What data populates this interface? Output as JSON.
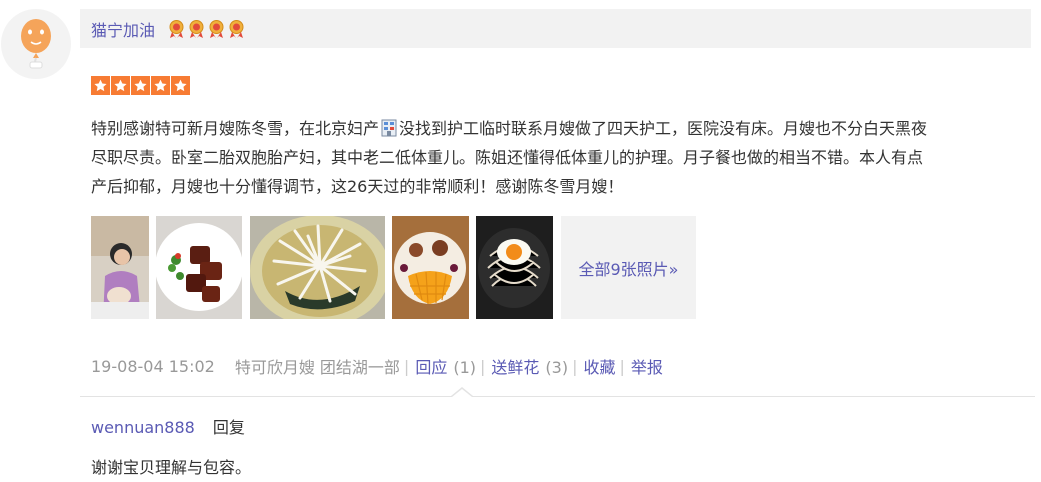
{
  "review": {
    "author": "猫宁加油",
    "medal_count": 4,
    "rating": 5,
    "rating_max": 5,
    "text_lines": [
      "特别感谢特可新月嫂陈冬雪，在北京妇产",
      "没找到护工临时联系月嫂做了四天护工，医院没有床。月嫂也不分白天黑夜",
      "尽职尽责。卧室二胎双胞胎产妇，其中老二低体重儿。陈姐还懂得低体重儿的护理。月子餐也做的相当不错。本人有点",
      "产后抑郁，月嫂也十分懂得调节，这26天过的非常顺利！感谢陈冬雪月嫂！"
    ],
    "photos": [
      {
        "icon": "photo-mother-baby"
      },
      {
        "icon": "photo-braised-pork"
      },
      {
        "icon": "photo-noodle-soup"
      },
      {
        "icon": "photo-mango-plate"
      },
      {
        "icon": "photo-egg-pan"
      }
    ],
    "more_photos_label": "全部9张照片»",
    "meta": {
      "datetime": "19-08-04 15:02",
      "shop": "特可欣月嫂 团结湖一部",
      "reply_label": "回应",
      "reply_count": "(1)",
      "flower_label": "送鲜花",
      "flower_count": "(3)",
      "favorite_label": "收藏",
      "report_label": "举报",
      "separator": "|"
    }
  },
  "reply": {
    "user": "wennuan888",
    "label": "回复",
    "text": "谢谢宝贝理解与包容。"
  },
  "colors": {
    "link": "#5a5ab4",
    "star": "#f77b33",
    "muted": "#999999",
    "header_bg": "#f2f2f2"
  }
}
